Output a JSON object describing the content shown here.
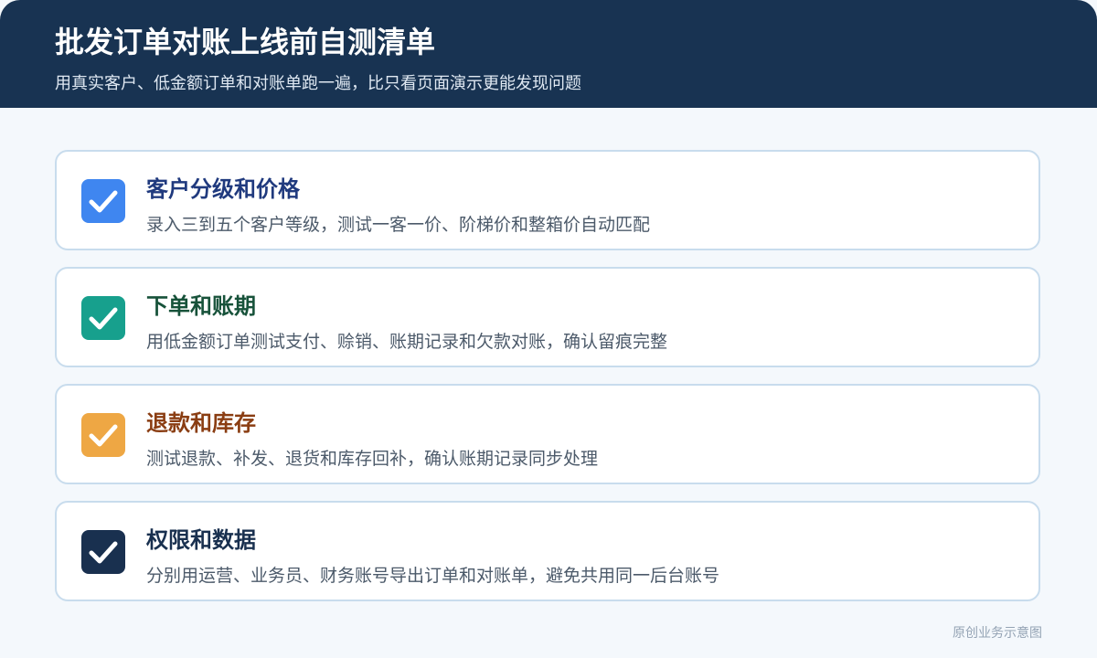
{
  "header": {
    "title": "批发订单对账上线前自测清单",
    "subtitle": "用真实客户、低金额订单和对账单跑一遍，比只看页面演示更能发现问题"
  },
  "items": [
    {
      "title": "客户分级和价格",
      "description": "录入三到五个客户等级，测试一客一价、阶梯价和整箱价自动匹配",
      "icon": "checkbox-checked-icon",
      "icon_color": "#3f86f0",
      "title_color": "#203a7e"
    },
    {
      "title": "下单和账期",
      "description": "用低金额订单测试支付、赊销、账期记录和欠款对账，确认留痕完整",
      "icon": "checkbox-checked-icon",
      "icon_color": "#17a08d",
      "title_color": "#17523a"
    },
    {
      "title": "退款和库存",
      "description": "测试退款、补发、退货和库存回补，确认账期记录同步处理",
      "icon": "checkbox-checked-icon",
      "icon_color": "#eea744",
      "title_color": "#8a3d12"
    },
    {
      "title": "权限和数据",
      "description": "分别用运营、业务员、财务账号导出订单和对账单，避免共用同一后台账号",
      "icon": "checkbox-checked-icon",
      "icon_color": "#19304f",
      "title_color": "#19304f"
    }
  ],
  "footer": {
    "note": "原创业务示意图"
  }
}
